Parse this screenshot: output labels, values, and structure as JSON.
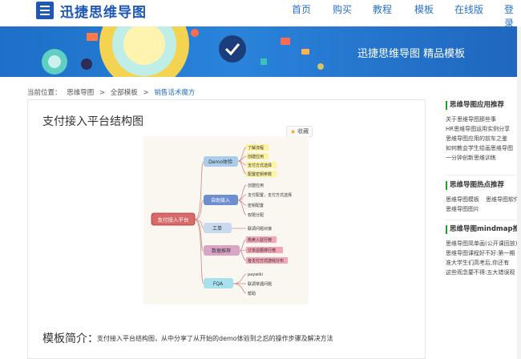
{
  "header": {
    "logo_text": "迅捷思维导图",
    "nav": [
      "首页",
      "购买",
      "教程",
      "模板",
      "在线版",
      "登录"
    ]
  },
  "banner": {
    "title": "迅捷思维导图 精品模板"
  },
  "breadcrumb": {
    "prefix": "当前位置：",
    "items": [
      "思维导图",
      "全部模板",
      "销售话术魔方"
    ],
    "separator": ">"
  },
  "template": {
    "title": "支付接入平台结构图",
    "favorite_label": "收藏",
    "intro_label": "模板简介：",
    "intro_text": "支付接入平台结构图，从中分享了从开始的demo体验到之后的操作步骤及解决方法"
  },
  "mindmap": {
    "root": "支付接入平台",
    "branches": [
      {
        "label": "Demo体验",
        "color": "#a9cdea",
        "children": [
          "了解流程",
          "创建应用",
          "支付方式选择",
          "配置密钥参数"
        ],
        "leaf_style": "yellow"
      },
      {
        "label": "自助接入",
        "color": "#6d8fd1",
        "children": [
          "创建应用",
          "支付配置，支付方式选择",
          "密钥配置",
          "权限分配"
        ],
        "leaf_style": "plain"
      },
      {
        "label": "工单",
        "color": "#c9d9ef",
        "children": [
          "联调问题对接"
        ],
        "leaf_style": "plain"
      },
      {
        "label": "数据推荐",
        "color": "#d9a4c6",
        "children": [
          "热卖入驻行榜",
          "订单总额排行榜",
          "各支付方式游戏分布"
        ],
        "leaf_style": "pink"
      },
      {
        "label": "FQA",
        "color": "#a9e0ee",
        "children": [
          "paywiki",
          "联调常遇问题",
          "帮助"
        ],
        "leaf_style": "plain"
      }
    ]
  },
  "sidebar": {
    "sections": [
      {
        "heading": "思维导图应用推荐",
        "links": [
          "关于思维导图那些事",
          "HR思维导图运用实例分享",
          "思维导图应用的前车之鉴",
          "如何教会学生绘画思维导图",
          "一分钟创新思维训练"
        ]
      },
      {
        "heading": "思维导图热点推荐",
        "links": [
          "思维导图模板",
          "思维导图图片",
          "思维导图软件"
        ]
      },
      {
        "heading": "思维导图mindmap推荐",
        "links": [
          "思维导图简单画(公开课回放)",
          "思维导图课程好不好:第一期",
          "准大学生们高考后,你还有",
          "这些观念要不得:五大错误观"
        ]
      }
    ]
  },
  "colors": {
    "brand": "#1e58b6",
    "link": "#2a72c7",
    "banner": "#2a83da",
    "accent_green": "#2a9a2a"
  }
}
